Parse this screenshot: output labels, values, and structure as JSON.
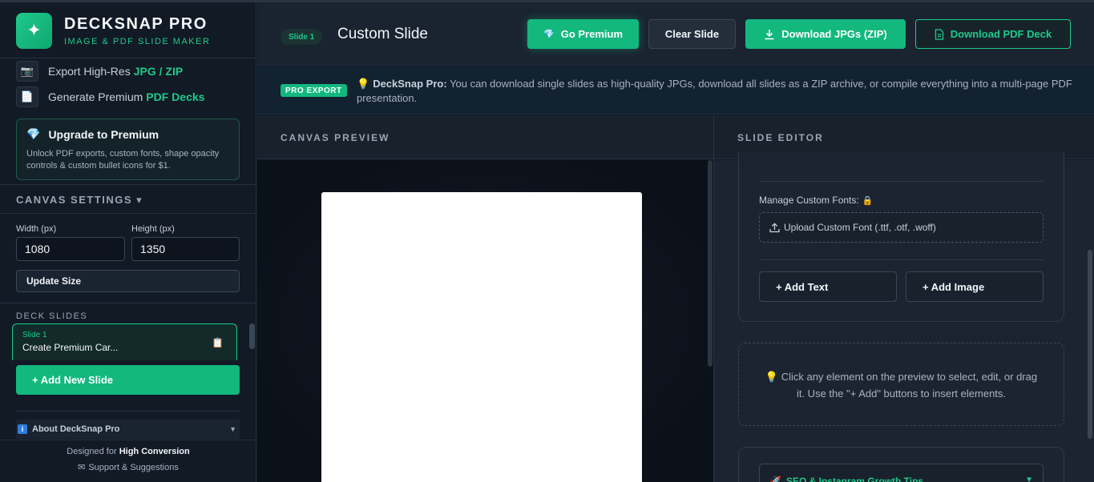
{
  "brand": {
    "name": "DECKSNAP PRO",
    "subtitle": "IMAGE & PDF SLIDE MAKER",
    "logo_icon": "sparkle-icon"
  },
  "features": [
    {
      "icon": "camera-icon",
      "text": "Export High-Res",
      "highlight": "JPG / ZIP"
    },
    {
      "icon": "document-icon",
      "text": "Generate Premium",
      "highlight": "PDF Decks"
    }
  ],
  "upgrade": {
    "title": "Upgrade to Premium",
    "description": "Unlock PDF exports, custom fonts, shape opacity controls & custom bullet icons for $1."
  },
  "canvas_settings": {
    "heading": "CANVAS SETTINGS ▾",
    "width_label": "Width (px)",
    "width_value": "1080",
    "height_label": "Height (px)",
    "height_value": "1350",
    "update_label": "Update Size"
  },
  "deck": {
    "heading": "DECK SLIDES",
    "slides": [
      {
        "number": "Slide 1",
        "title": "Create Premium Car..."
      }
    ],
    "add_label": "+ Add New Slide"
  },
  "about": {
    "label": "About DeckSnap Pro"
  },
  "footer": {
    "designed_prefix": "Designed for",
    "designed_bold": "High Conversion",
    "support": "Support & Suggestions"
  },
  "header": {
    "slide_pill": "Slide 1",
    "title": "Custom Slide",
    "go_premium": "Go Premium",
    "clear_slide": "Clear Slide",
    "download_jpgs": "Download JPGs (ZIP)",
    "download_pdf": "Download PDF Deck"
  },
  "pro_banner": {
    "badge": "PRO EXPORT",
    "lead": "DeckSnap Pro:",
    "text": "You can download single slides as high-quality JPGs, download all slides as a ZIP archive, or compile everything into a multi-page PDF presentation."
  },
  "preview": {
    "heading": "CANVAS PREVIEW"
  },
  "editor": {
    "heading": "SLIDE EDITOR",
    "fonts_label": "Manage Custom Fonts:",
    "upload_label": "Upload Custom Font (.ttf, .otf, .woff)",
    "add_text": "+ Add Text",
    "add_image": "+ Add Image",
    "hint": "Click any element on the preview to select, edit, or drag it. Use the \"+ Add\" buttons to insert elements.",
    "growth_tips": "SEO & Instagram Growth Tips"
  },
  "colors": {
    "accent": "#13b87e",
    "accent_text": "#1ec98a",
    "background": "#0f1722",
    "panel": "#1a2330"
  }
}
